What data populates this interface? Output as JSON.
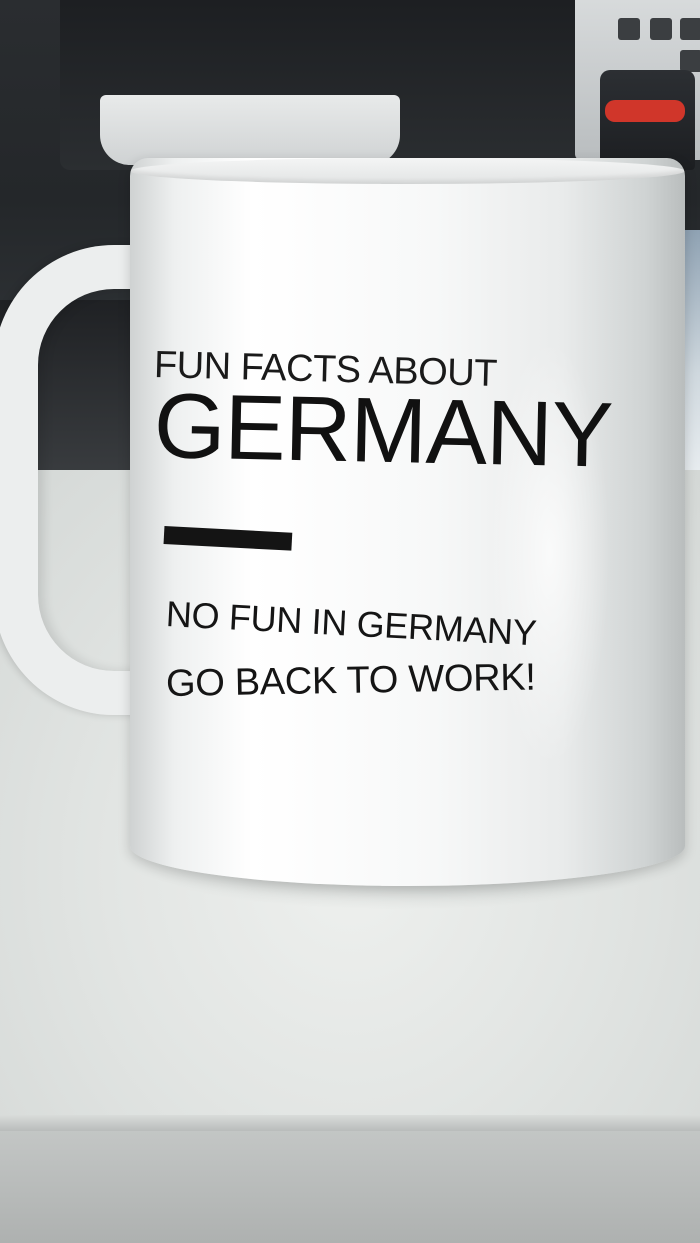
{
  "mug": {
    "line_top": "FUN FACTS ABOUT",
    "headline": "GERMANY",
    "line_1": "NO FUN IN GERMANY",
    "line_2": "GO BACK TO WORK!"
  },
  "colors": {
    "mug": "#f4f5f5",
    "print": "#141414",
    "desk": "#e3e6e4",
    "background": "#26292c"
  }
}
